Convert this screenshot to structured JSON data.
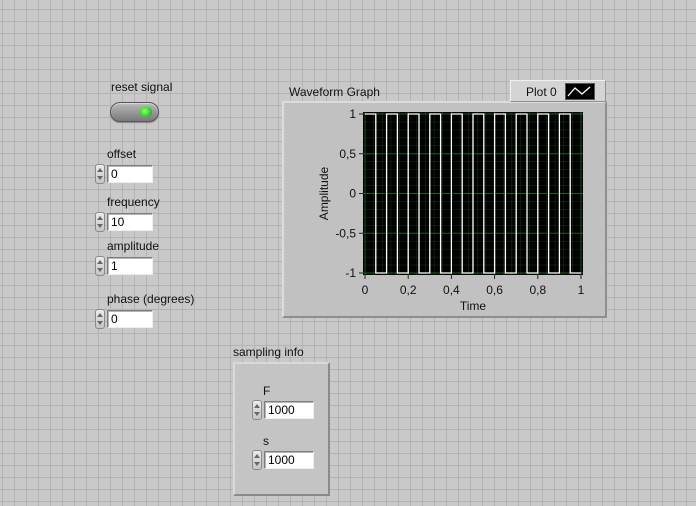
{
  "reset_signal": {
    "label": "reset signal"
  },
  "controls": {
    "offset": {
      "label": "offset",
      "value": "0"
    },
    "frequency": {
      "label": "frequency",
      "value": "10"
    },
    "amplitude": {
      "label": "amplitude",
      "value": "1"
    },
    "phase": {
      "label": "phase (degrees)",
      "value": "0"
    }
  },
  "sampling": {
    "label": "sampling info",
    "F": {
      "label": "F",
      "value": "1000"
    },
    "s": {
      "label": "s",
      "value": "1000"
    }
  },
  "graph": {
    "title": "Waveform Graph",
    "legend_label": "Plot 0"
  },
  "chart_data": {
    "type": "line",
    "title": "Waveform Graph",
    "xlabel": "Time",
    "ylabel": "Amplitude",
    "xlim": [
      0,
      1
    ],
    "ylim": [
      -1,
      1
    ],
    "x_ticks": [
      "0",
      "0,2",
      "0,4",
      "0,6",
      "0,8",
      "1"
    ],
    "y_ticks": [
      "1",
      "0,5",
      "0",
      "-0,5",
      "-1"
    ],
    "grid": true,
    "series": [
      {
        "name": "Plot 0",
        "waveform": "square",
        "frequency": 10,
        "amplitude": 1,
        "offset": 0,
        "phase_deg": 0,
        "color": "#ffffff"
      }
    ],
    "colors": {
      "plot_bg": "#000000",
      "grid": "#1f6b1f",
      "trace": "#ffffff"
    }
  }
}
